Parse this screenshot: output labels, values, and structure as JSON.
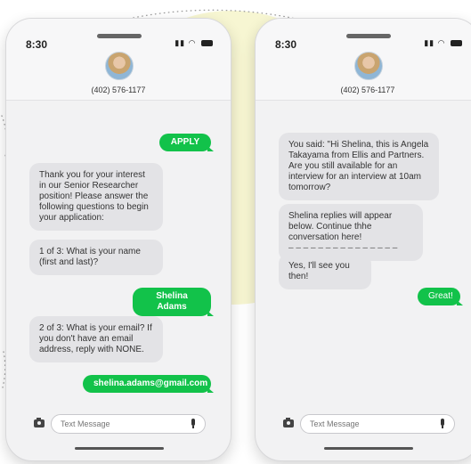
{
  "colors": {
    "outgoing_bubble": "#12c24a",
    "incoming_bubble": "#e3e3e6",
    "background_blob": "#f7f6d2"
  },
  "icons": [
    "camera-icon",
    "microphone-icon",
    "signal-icon",
    "wifi-icon",
    "battery-icon"
  ],
  "phones": [
    {
      "time": "8:30",
      "contact_number": "(402) 576-1177",
      "input_placeholder": "Text Message",
      "messages": [
        {
          "from": "user",
          "text": "APPLY"
        },
        {
          "from": "bot",
          "text": "Thank you for your interest in our Senior Researcher position! Please answer the following questions to begin your application:"
        },
        {
          "from": "bot",
          "text": "1 of 3: What is your name (first and last)?"
        },
        {
          "from": "user",
          "text": "Shelina Adams"
        },
        {
          "from": "bot",
          "text": "2 of 3: What is your email? If you don't have an email address, reply with NONE."
        },
        {
          "from": "user",
          "text": "shelina.adams@gmail.com"
        }
      ]
    },
    {
      "time": "8:30",
      "contact_number": "(402) 576-1177",
      "input_placeholder": "Text Message",
      "messages": [
        {
          "from": "bot",
          "text": "You said: \"Hi Shelina, this is Angela Takayama from Ellis and Partners. Are you still available for an interview for an interview at 10am tomorrow?"
        },
        {
          "from": "bot",
          "text": "Shelina replies will appear below. Continue thhe conversation here!",
          "dashes": "– – – – – – – – – – – – – – –"
        },
        {
          "from": "bot",
          "text": "Yes, I'll see you then!"
        },
        {
          "from": "user",
          "text": "Great!"
        }
      ]
    }
  ]
}
